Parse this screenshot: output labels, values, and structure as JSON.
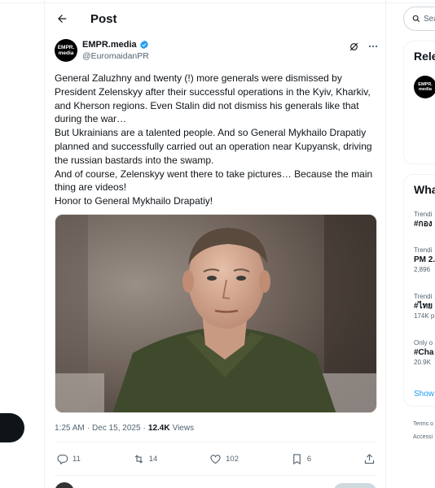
{
  "header": {
    "title": "Post"
  },
  "author": {
    "display_name": "EMPR.media",
    "handle": "@EuromaidanPR",
    "avatar_text_1": "EMPR.",
    "avatar_text_2": "media"
  },
  "tweet": {
    "paragraphs": [
      "General Zaluzhny and twenty (!) more generals were dismissed by President Zelenskyy after their successful operations in the Kyiv, Kharkiv, and Kherson regions. Even Stalin did not dismiss his generals like that during the war…",
      "But Ukrainians are a talented people. And so General Mykhailo Drapatiy planned and successfully carried out an operation near Kupyansk, driving the russian bastards into the swamp.",
      "And of course, Zelenskyy went there to take pictures… Because the main thing are videos!",
      "Honor to General Mykhailo Drapatiy!"
    ]
  },
  "meta": {
    "time": "1:25 AM",
    "separator": "·",
    "date": "Dec 15, 2025",
    "views_count": "12.4K",
    "views_label": "Views"
  },
  "actions": {
    "replies": "11",
    "reposts": "14",
    "likes": "102",
    "bookmarks": "6"
  },
  "sidebar": {
    "search_placeholder": "Sea",
    "relevant_title": "Rele",
    "whats_title": "Wha",
    "trends": [
      {
        "label": "Trendi",
        "name": "#กอง",
        "count": ""
      },
      {
        "label": "Trendi",
        "name": "PM 2.",
        "count": "2,896"
      },
      {
        "label": "Trendi",
        "name": "#ไทย",
        "count": "174K p"
      },
      {
        "label": "Only o",
        "name": "#Cha",
        "count": "20.9K"
      }
    ],
    "show_more": "Show",
    "footer_1": "Terms o",
    "footer_2": "Accessi"
  },
  "colors": {
    "verified": "#1d9bf0",
    "text_secondary": "#536471",
    "link": "#1d9bf0"
  }
}
